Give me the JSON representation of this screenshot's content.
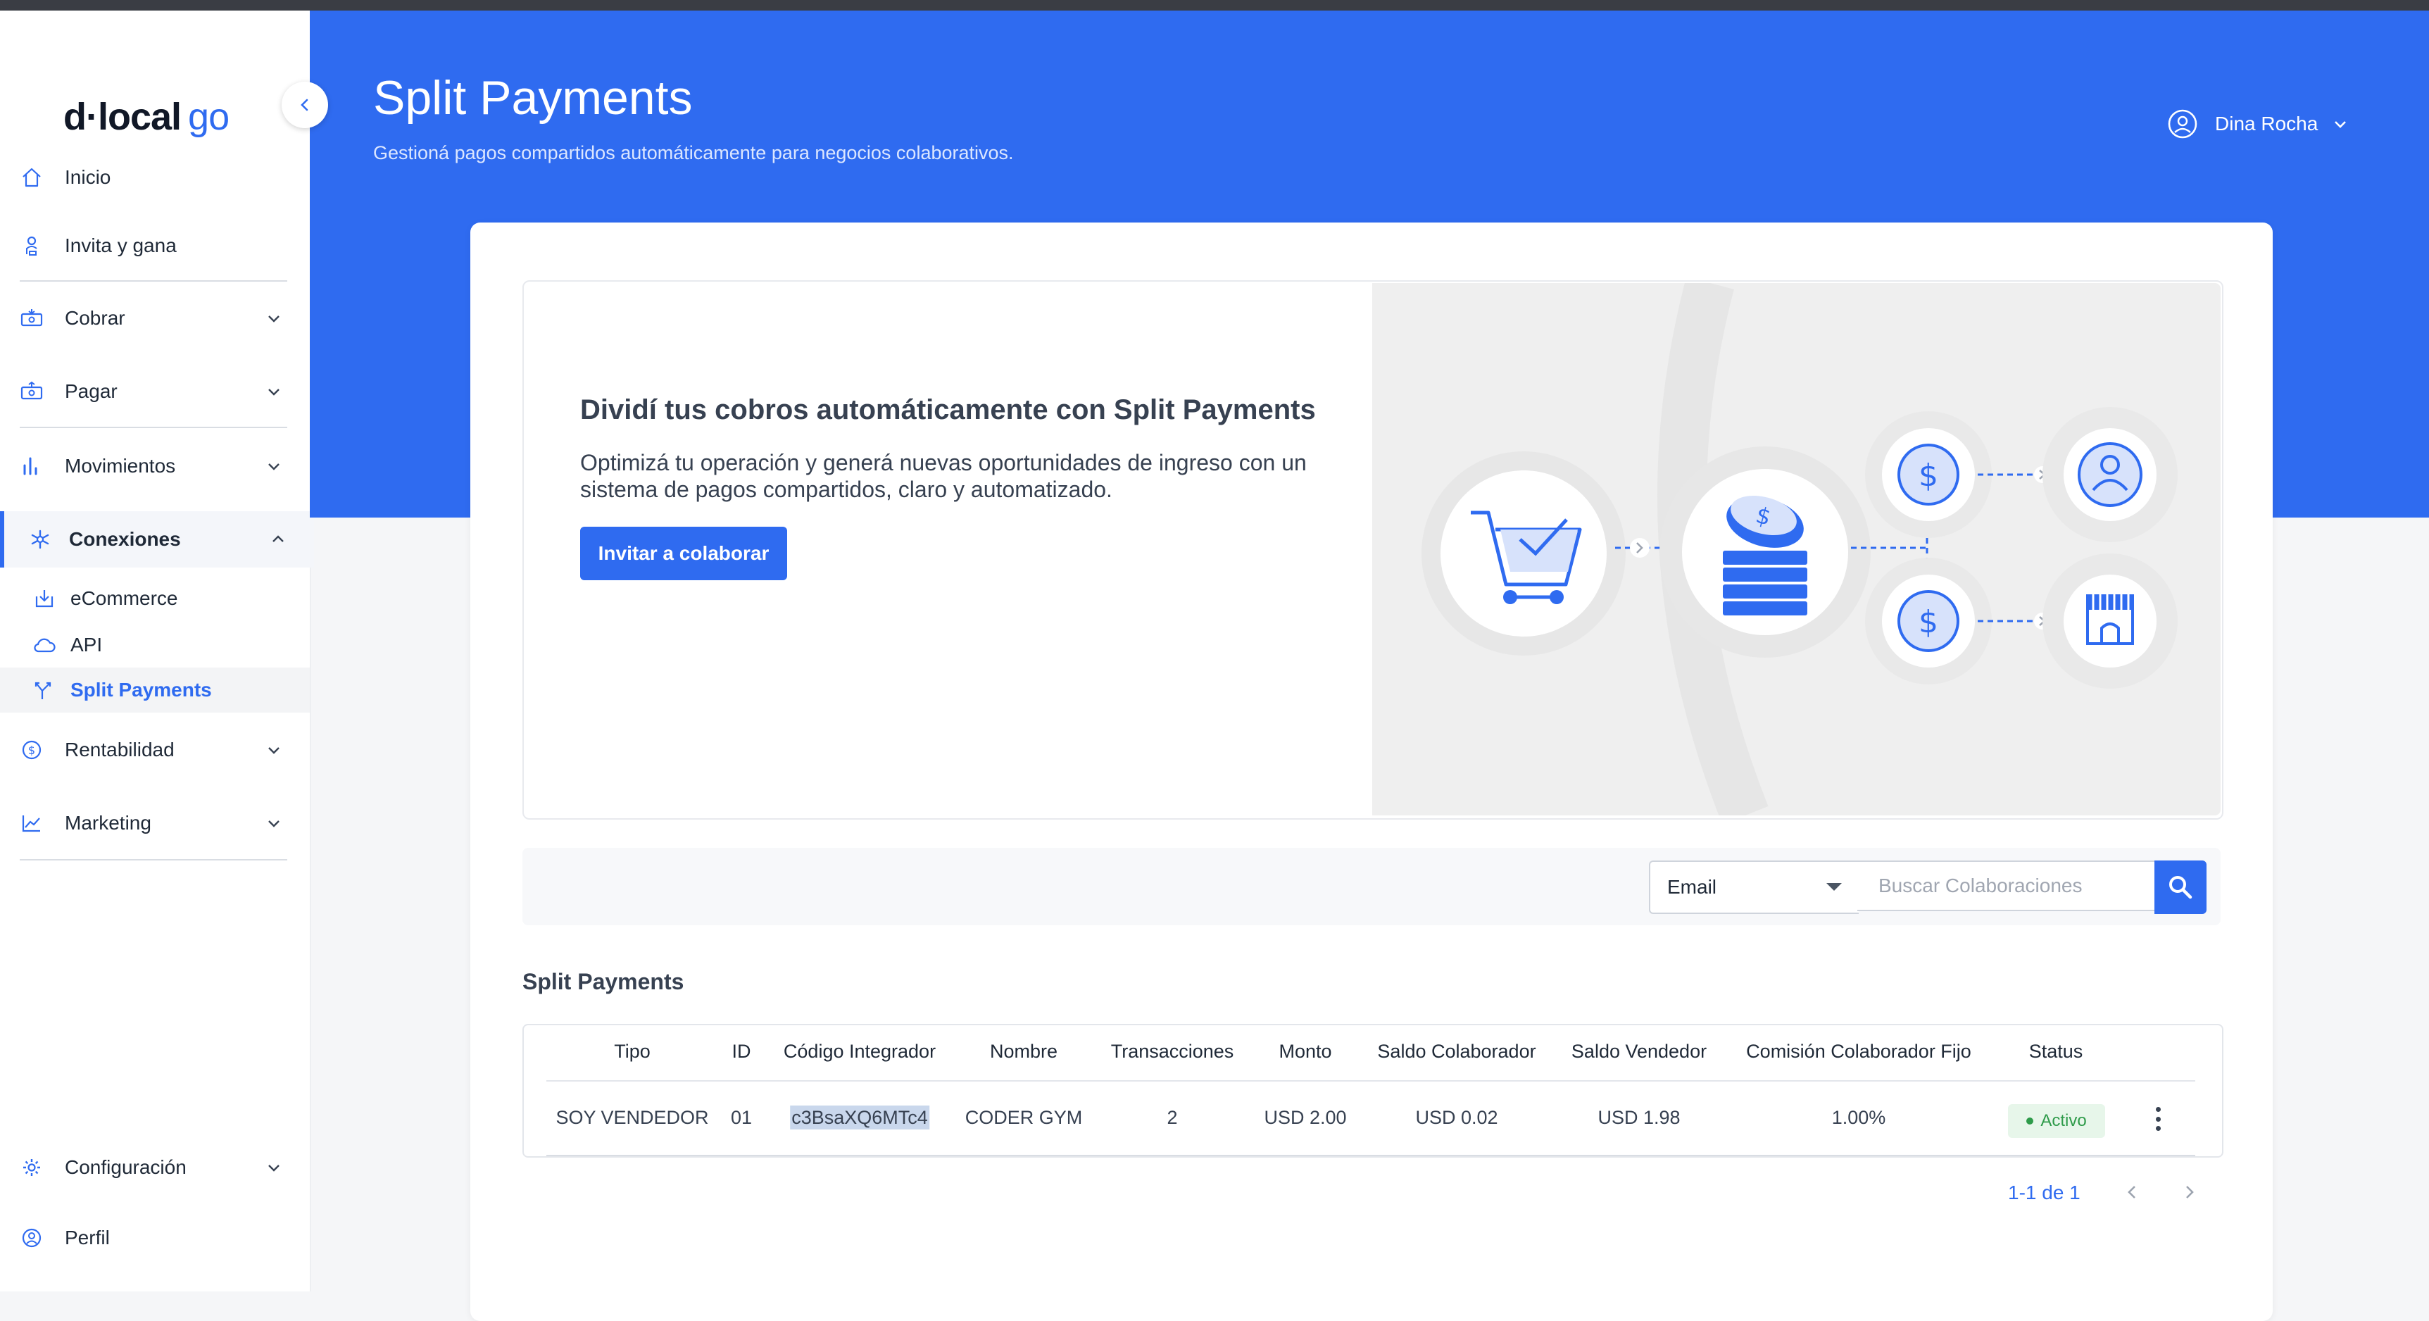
{
  "app": {
    "brand_main": "d·local",
    "brand_suffix": "go"
  },
  "sidebar": {
    "items": [
      {
        "label": "Inicio",
        "icon": "home-icon"
      },
      {
        "label": "Invita y gana",
        "icon": "user-gift-icon"
      },
      {
        "label": "Cobrar",
        "icon": "receive-icon"
      },
      {
        "label": "Pagar",
        "icon": "pay-icon"
      },
      {
        "label": "Movimientos",
        "icon": "bar-chart-icon"
      },
      {
        "label": "Conexiones",
        "icon": "connections-icon"
      },
      {
        "label": "Rentabilidad",
        "icon": "dollar-circle-icon"
      },
      {
        "label": "Marketing",
        "icon": "line-chart-icon"
      }
    ],
    "sub_items": [
      {
        "label": "eCommerce",
        "icon": "download-box-icon"
      },
      {
        "label": "API",
        "icon": "cloud-icon"
      },
      {
        "label": "Split Payments",
        "icon": "split-icon"
      }
    ],
    "bottom": [
      {
        "label": "Configuración",
        "icon": "gear-icon"
      },
      {
        "label": "Perfil",
        "icon": "user-circle-icon"
      }
    ]
  },
  "header": {
    "title": "Split Payments",
    "subtitle": "Gestioná pagos compartidos automáticamente para negocios colaborativos.",
    "user_name": "Dina Rocha"
  },
  "banner": {
    "title": "Dividí tus cobros automáticamente con Split Payments",
    "text": "Optimizá tu operación y generá nuevas oportunidades de ingreso con un sistema de pagos compartidos, claro y automatizado.",
    "button": "Invitar a colaborar"
  },
  "filter": {
    "select_value": "Email",
    "search_placeholder": "Buscar Colaboraciones"
  },
  "table": {
    "section_title": "Split Payments",
    "columns": [
      "Tipo",
      "ID",
      "Código Integrador",
      "Nombre",
      "Transacciones",
      "Monto",
      "Saldo Colaborador",
      "Saldo Vendedor",
      "Comisión Colaborador Fijo",
      "Status"
    ],
    "rows": [
      {
        "tipo": "SOY VENDEDOR",
        "id": "01",
        "codigo": "c3BsaXQ6MTc4",
        "nombre": "CODER GYM",
        "transacciones": "2",
        "monto": "USD 2.00",
        "saldo_colaborador": "USD 0.02",
        "saldo_vendedor": "USD 1.98",
        "comision": "1.00%",
        "status": "Activo"
      }
    ]
  },
  "pagination": {
    "text": "1-1 de 1"
  },
  "colors": {
    "accent": "#2f6bf0",
    "status_active": "#2e9b4a"
  }
}
